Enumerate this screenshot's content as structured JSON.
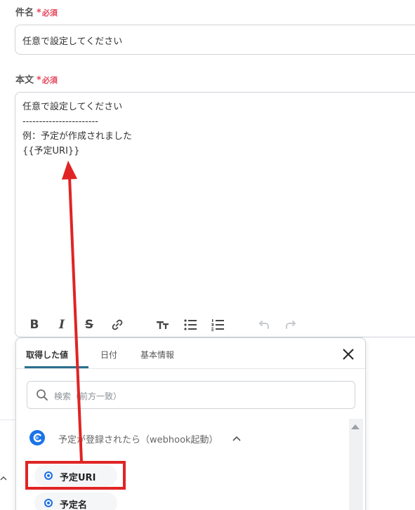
{
  "subject": {
    "label": "件名",
    "required_star": "*",
    "required_text": "必須",
    "value": "任意で設定してください"
  },
  "body": {
    "label": "本文",
    "required_star": "*",
    "required_text": "必須",
    "value": "任意で設定してください\n-----------------------\n例：予定が作成されました\n{{予定URI}}"
  },
  "toolbar": {
    "icons": [
      "bold-icon",
      "italic-icon",
      "strikethrough-icon",
      "link-icon",
      "font-size-icon",
      "bullet-list-icon",
      "numbered-list-icon",
      "undo-icon",
      "redo-icon"
    ],
    "bold_glyph": "B",
    "italic_glyph": "I",
    "strike_glyph": "S"
  },
  "popup": {
    "tabs": [
      {
        "label": "取得した値"
      },
      {
        "label": "日付"
      },
      {
        "label": "基本情報"
      }
    ],
    "search_placeholder": "検索（前方一致）",
    "trigger_label": "予定が登録されたら（webhook起動）",
    "items": [
      {
        "label": "予定URI"
      },
      {
        "label": "予定名"
      }
    ]
  },
  "colors": {
    "required": "#e8465a",
    "accent_tab": "#2b6f8e",
    "item_dot": "#1e6fe8",
    "annotation": "#e02424"
  }
}
